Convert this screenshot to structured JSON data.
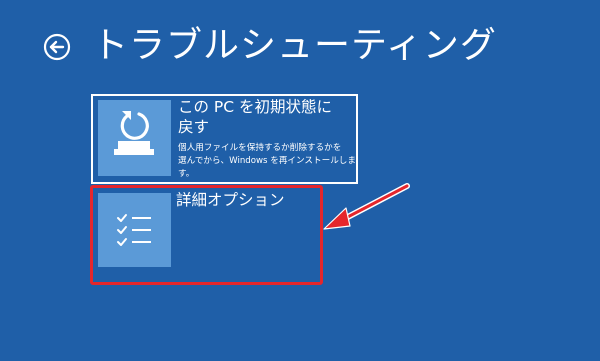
{
  "header": {
    "title": "トラブルシューティング",
    "back_icon": "back-arrow-icon"
  },
  "options": {
    "reset": {
      "title_line1": "この PC を初期状態に",
      "title_line2": "戻す",
      "desc_line1": "個人用ファイルを保持するか削除するかを",
      "desc_line2": "選んでから、Windows を再インストールしま",
      "desc_line3": "す。",
      "icon": "reset-pc-icon"
    },
    "advanced": {
      "title": "詳細オプション",
      "icon": "checklist-icon"
    }
  },
  "annotation": {
    "highlight_color": "#e5262c"
  },
  "colors": {
    "background": "#1f5fa8",
    "tile_icon_bg": "#5b9ad7",
    "text": "#ffffff"
  }
}
